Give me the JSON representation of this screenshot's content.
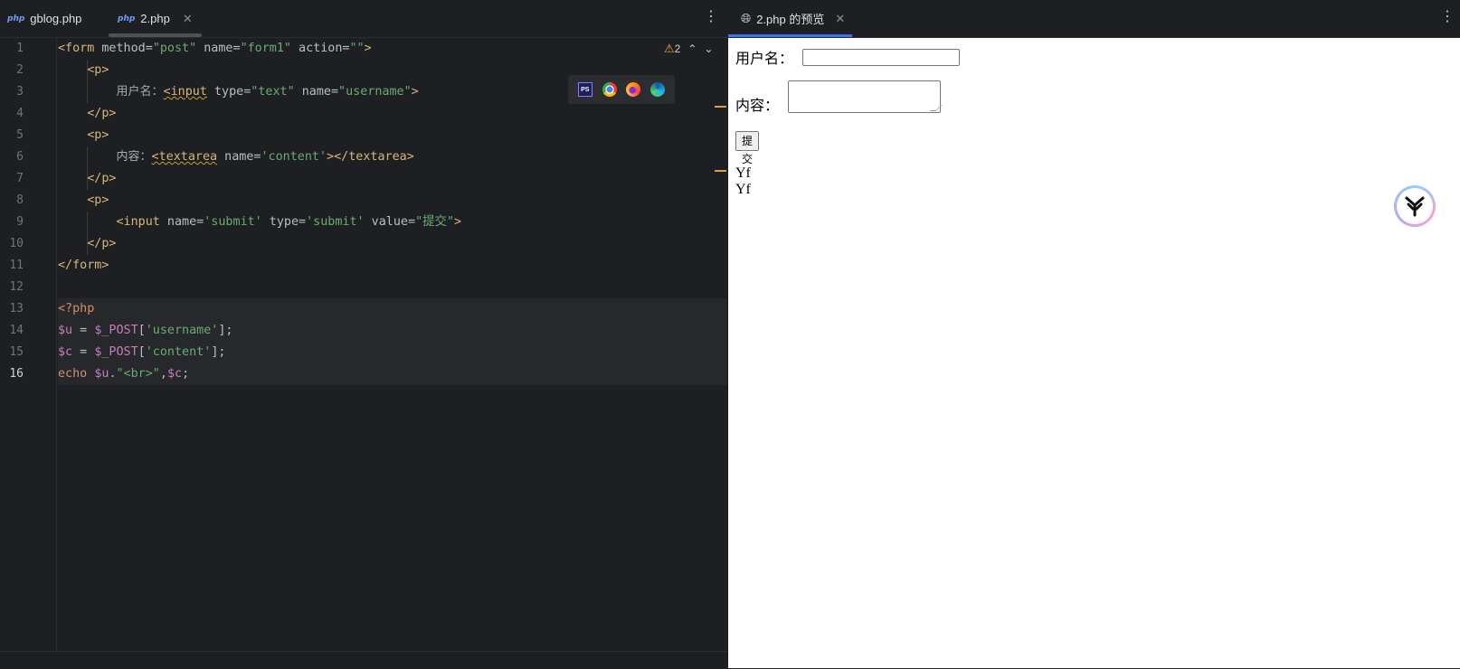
{
  "editor": {
    "tabs": [
      {
        "icon": "php",
        "label": "gblog.php"
      },
      {
        "icon": "php",
        "label": "2.php"
      }
    ],
    "warning_count": "2",
    "line_numbers": [
      "1",
      "2",
      "3",
      "4",
      "5",
      "6",
      "7",
      "8",
      "9",
      "10",
      "11",
      "12",
      "13",
      "14",
      "15",
      "16"
    ],
    "code": {
      "l1": [
        "<form",
        " method=",
        "\"post\"",
        " name=",
        "\"form1\"",
        " action=",
        "\"\"",
        ">"
      ],
      "l2": "<p>",
      "l3": [
        "用户名：",
        "<input",
        " type=",
        "\"text\"",
        " name=",
        "\"username\"",
        ">"
      ],
      "l4": "</p>",
      "l5": "<p>",
      "l6": [
        "内容：",
        "<textarea",
        " name=",
        "'content'",
        "></textarea>"
      ],
      "l7": "</p>",
      "l8": "<p>",
      "l9": [
        "<input",
        " name=",
        "'submit'",
        " type=",
        "'submit'",
        " value=",
        "\"提交\"",
        ">"
      ],
      "l10": "</p>",
      "l11": "</form>",
      "l13": "<?php",
      "l14": [
        "$u",
        " = ",
        "$_POST",
        "[",
        "'username'",
        "];"
      ],
      "l15": [
        "$c",
        " = ",
        "$_POST",
        "[",
        "'content'",
        "];"
      ],
      "l16": [
        "echo ",
        "$u",
        ".",
        "\"<br>\"",
        ",",
        "$c",
        ";"
      ]
    },
    "browser_icons": [
      "phpstorm-icon",
      "chrome-icon",
      "firefox-icon",
      "edge-icon"
    ]
  },
  "preview": {
    "tab_label": "2.php 的预览",
    "username_label": "用户名：",
    "content_label": "内容：",
    "submit_label": "提交",
    "output_line1": "Yf",
    "output_line2": "Yf"
  }
}
